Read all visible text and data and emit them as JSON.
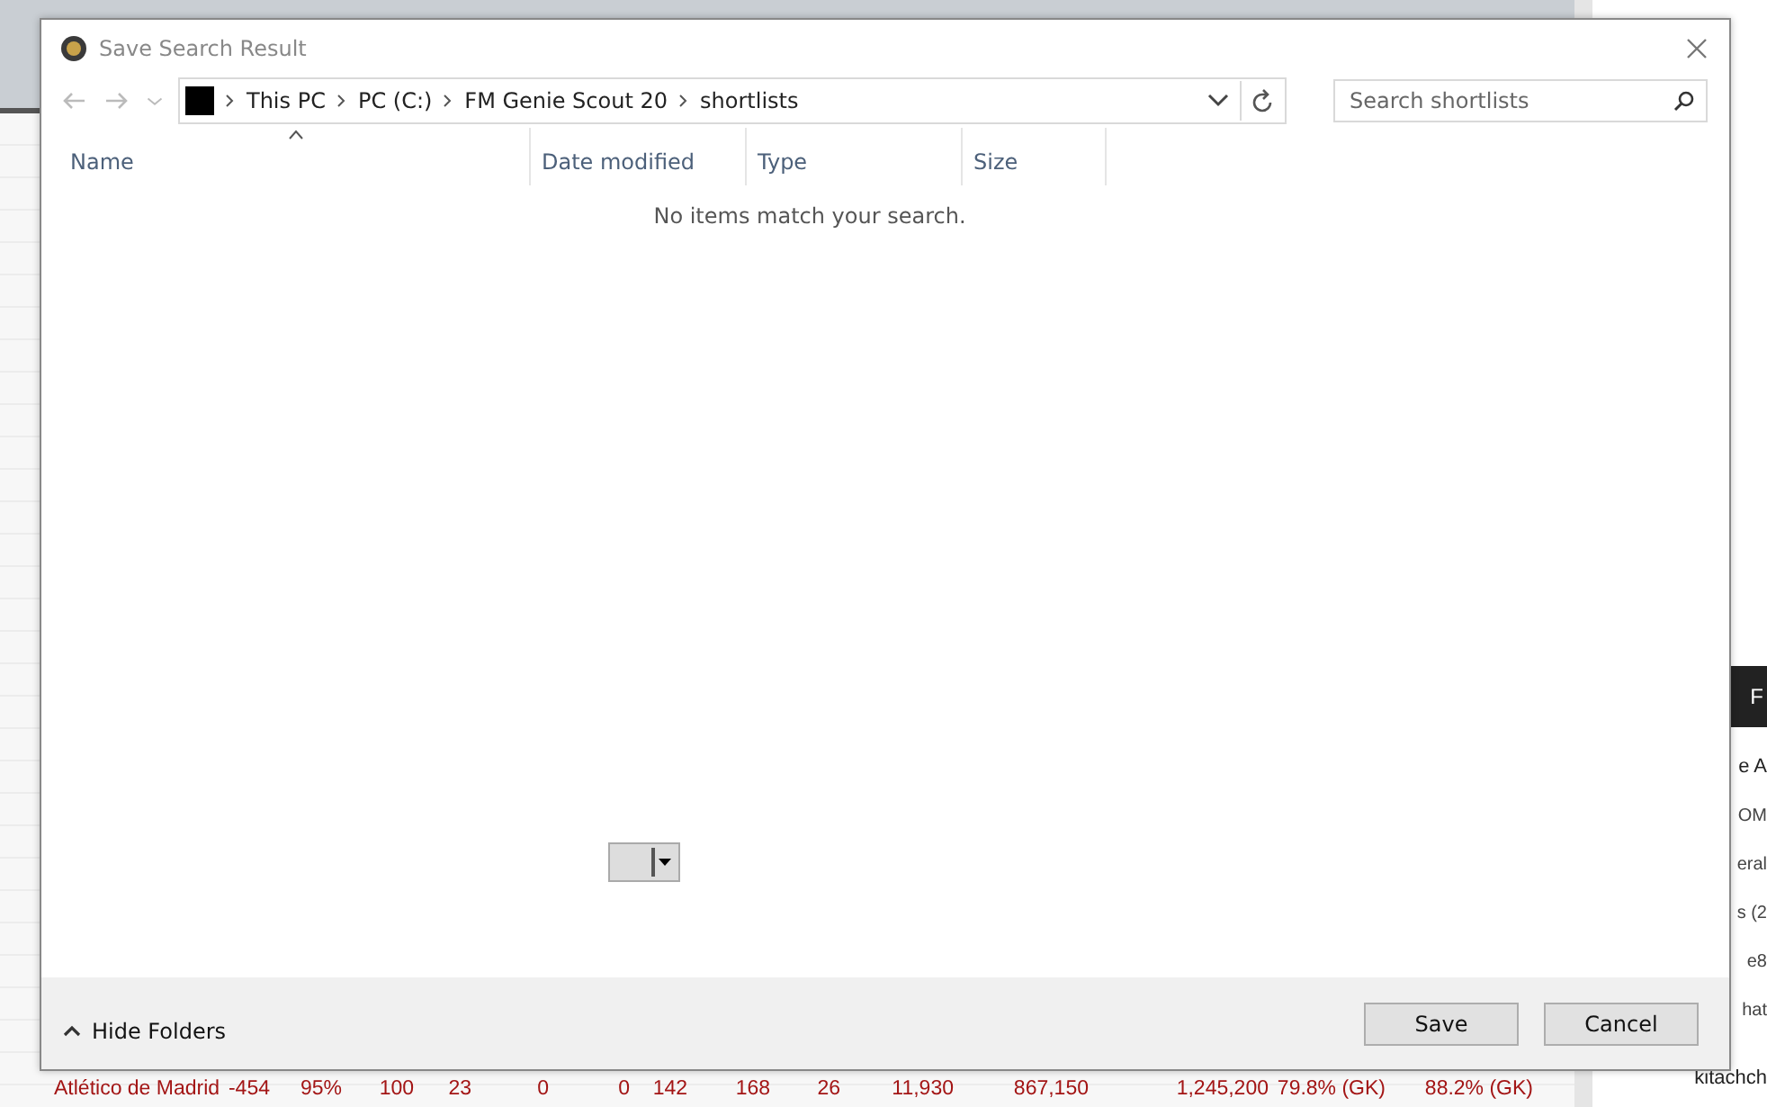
{
  "dialog": {
    "title": "Save Search Result",
    "breadcrumbs": [
      "This PC",
      "PC (C:)",
      "FM Genie Scout 20",
      "shortlists"
    ],
    "search": {
      "placeholder": "Search shortlists"
    },
    "columns": [
      {
        "label": "Name",
        "sorted": true
      },
      {
        "label": "Date modified",
        "sorted": false
      },
      {
        "label": "Type",
        "sorted": false
      },
      {
        "label": "Size",
        "sorted": false
      }
    ],
    "empty_message": "No items match your search.",
    "hide_folders": "Hide Folders",
    "buttons": [
      {
        "label": "Save"
      },
      {
        "label": "Cancel"
      }
    ]
  },
  "background_table": {
    "rows": [
      [
        "Atlético de Madrid",
        "-454",
        "95%",
        "100",
        "23",
        "0",
        "0",
        "142",
        "168",
        "26",
        "11,930",
        "867,150",
        "1,245,200",
        "79.8% (GK)",
        "88.2% (GK)"
      ]
    ]
  },
  "background_sidebar": {
    "items": [
      {
        "text": "F",
        "kind": "header"
      },
      {
        "text": "e A",
        "kind": "title"
      },
      {
        "text": "OM",
        "kind": "text"
      },
      {
        "text": "eral",
        "kind": "text"
      },
      {
        "text": "s (2",
        "kind": "text"
      },
      {
        "text": "e8",
        "kind": "text"
      },
      {
        "text": "hat",
        "kind": "text"
      },
      {
        "text": "kitachch",
        "kind": "user"
      }
    ]
  }
}
